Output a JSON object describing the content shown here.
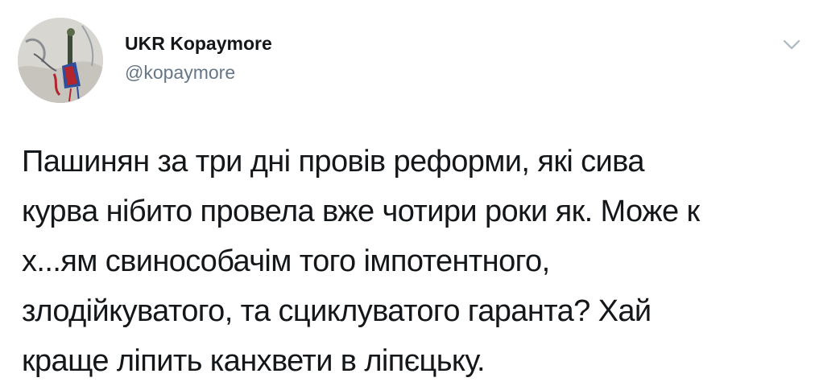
{
  "tweet": {
    "author": {
      "display_name": "UKR Kopaymore",
      "handle": "@kopaymore",
      "avatar_icon": "avatar-painting-icon"
    },
    "menu_icon": "chevron-down-icon",
    "text": "Пашинян за три дні провів реформи, які сива\nкурва нібито провела вже чотири роки як. Може к\nх...ям свиносoбачім того імпотентного,\nзлодійкуватого, та сциклуватого гаранта? Хай\nкраще ліпить канхвети в ліпєцьку."
  },
  "colors": {
    "text": "#14171a",
    "secondary_text": "#657786",
    "caret": "#aab8c2",
    "background": "#ffffff"
  }
}
